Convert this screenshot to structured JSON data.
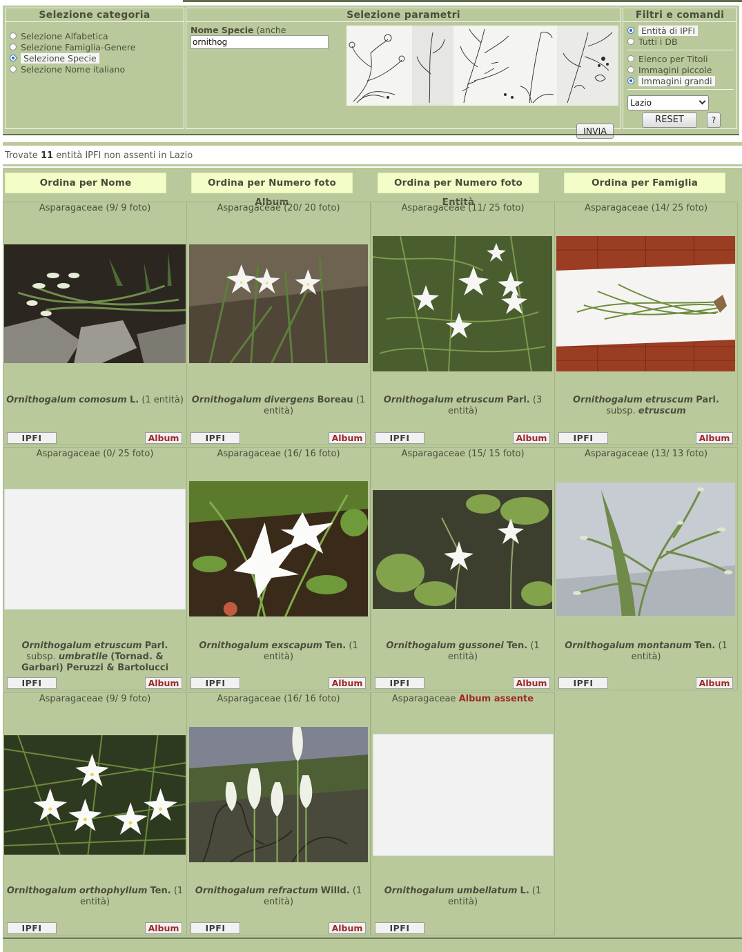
{
  "panels": {
    "categoria": {
      "title": "Selezione categoria",
      "options": [
        {
          "label": "Selezione Alfabetica",
          "checked": false
        },
        {
          "label": "Selezione Famiglia-Genere",
          "checked": false
        },
        {
          "label": "Selezione Specie",
          "checked": true
        },
        {
          "label": "Selezione Nome italiano",
          "checked": false
        }
      ]
    },
    "parametri": {
      "title": "Selezione parametri",
      "field_label_bold": "Nome Specie",
      "field_label_rest": "(anche",
      "field_value": "ornithog",
      "submit_label": "INVIA"
    },
    "filtri": {
      "title": "Filtri e comandi",
      "scope": [
        {
          "label": "Entità di IPFI",
          "checked": true
        },
        {
          "label": "Tutti i DB",
          "checked": false
        }
      ],
      "view": [
        {
          "label": "Elenco per Titoli",
          "checked": false
        },
        {
          "label": "Immagini piccole",
          "checked": false
        },
        {
          "label": "Immagini grandi",
          "checked": true
        }
      ],
      "region_selected": "Lazio",
      "reset_label": "RESET",
      "help_label": "?"
    }
  },
  "result": {
    "prefix": "Trovate",
    "count": "11",
    "suffix": "entità IPFI non assenti in Lazio"
  },
  "sort_buttons": [
    "Ordina per Nome",
    "Ordina per Numero foto Album",
    "Ordina per Numero foto Entità",
    "Ordina per Famiglia"
  ],
  "buttons": {
    "ipfi": "IPFI",
    "album": "Album"
  },
  "species": [
    {
      "family": "Asparagaceae",
      "photos": "(9/ 9 foto)",
      "genus": "Ornithogalum",
      "epithet": "comosum",
      "author": "L.",
      "note": "(1 entità)",
      "has_album": true,
      "photo": true
    },
    {
      "family": "Asparagaceae",
      "photos": "(20/ 20 foto)",
      "genus": "Ornithogalum",
      "epithet": "divergens",
      "author": "Boreau",
      "note": "(1 entità)",
      "has_album": true,
      "photo": true
    },
    {
      "family": "Asparagaceae",
      "photos": "(11/ 25 foto)",
      "genus": "Ornithogalum",
      "epithet": "etruscum",
      "author": "Parl.",
      "note": "(3 entità)",
      "has_album": true,
      "photo": true
    },
    {
      "family": "Asparagaceae",
      "photos": "(14/ 25 foto)",
      "genus": "Ornithogalum",
      "epithet": "etruscum",
      "author": "Parl.",
      "subsp": "etruscum",
      "note": "",
      "has_album": true,
      "photo": true
    },
    {
      "family": "Asparagaceae",
      "photos": "(0/ 25 foto)",
      "genus": "Ornithogalum",
      "epithet": "etruscum",
      "author": "Parl.",
      "subsp": "umbratile",
      "subsp_author": "(Tornad. & Garbari) Peruzzi & Bartolucci",
      "note": "",
      "has_album": true,
      "photo": false
    },
    {
      "family": "Asparagaceae",
      "photos": "(16/ 16 foto)",
      "genus": "Ornithogalum",
      "epithet": "exscapum",
      "author": "Ten.",
      "note": "(1 entità)",
      "has_album": true,
      "photo": true
    },
    {
      "family": "Asparagaceae",
      "photos": "(15/ 15 foto)",
      "genus": "Ornithogalum",
      "epithet": "gussonei",
      "author": "Ten.",
      "note": "(1 entità)",
      "has_album": true,
      "photo": true
    },
    {
      "family": "Asparagaceae",
      "photos": "(13/ 13 foto)",
      "genus": "Ornithogalum",
      "epithet": "montanum",
      "author": "Ten.",
      "note": "(1 entità)",
      "has_album": true,
      "photo": true
    },
    {
      "family": "Asparagaceae",
      "photos": "(9/ 9 foto)",
      "genus": "Ornithogalum",
      "epithet": "orthophyllum",
      "author": "Ten.",
      "note": "(1 entità)",
      "has_album": true,
      "photo": true
    },
    {
      "family": "Asparagaceae",
      "photos": "(16/ 16 foto)",
      "genus": "Ornithogalum",
      "epithet": "refractum",
      "author": "Willd.",
      "note": "(1 entità)",
      "has_album": true,
      "photo": true
    },
    {
      "family": "Asparagaceae",
      "album_absent": "Album assente",
      "genus": "Ornithogalum",
      "epithet": "umbellatum",
      "author": "L.",
      "note": "(1 entità)",
      "has_album": false,
      "photo": false
    }
  ]
}
